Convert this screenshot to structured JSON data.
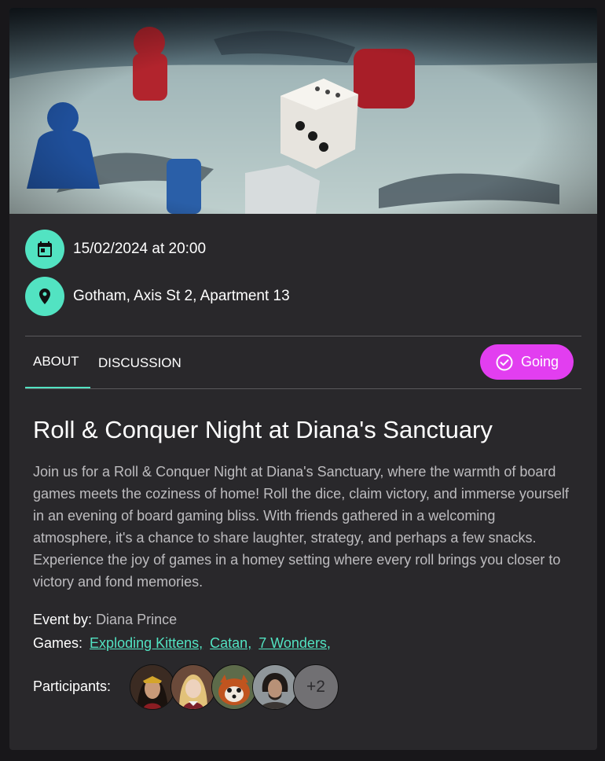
{
  "event": {
    "datetime": "15/02/2024 at 20:00",
    "location": "Gotham, Axis St 2, Apartment 13",
    "title": "Roll & Conquer Night at Diana's Sanctuary",
    "description": "Join us for a Roll & Conquer Night at Diana's Sanctuary, where the warmth of board games meets the coziness of home! Roll the dice, claim victory, and immerse yourself in an evening of board gaming bliss. With friends gathered in a welcoming atmosphere, it's a chance to share laughter, strategy, and perhaps a few snacks. Experience the joy of games in a homey setting where every roll brings you closer to victory and fond memories.",
    "host_label": "Event by:",
    "host_name": "Diana Prince",
    "games_label": "Games:",
    "games": [
      "Exploding Kittens,",
      "Catan,",
      "7 Wonders,"
    ],
    "participants_label": "Participants:",
    "participants_more": "+2"
  },
  "tabs": {
    "about": "ABOUT",
    "discussion": "DISCUSSION"
  },
  "actions": {
    "going_label": "Going"
  },
  "icons": {
    "date": "calendar-icon",
    "location": "map-pin-icon",
    "going": "check-circle-icon"
  },
  "colors": {
    "accent": "#52e3c2",
    "going": "#e23ef0",
    "card": "#29282b"
  }
}
